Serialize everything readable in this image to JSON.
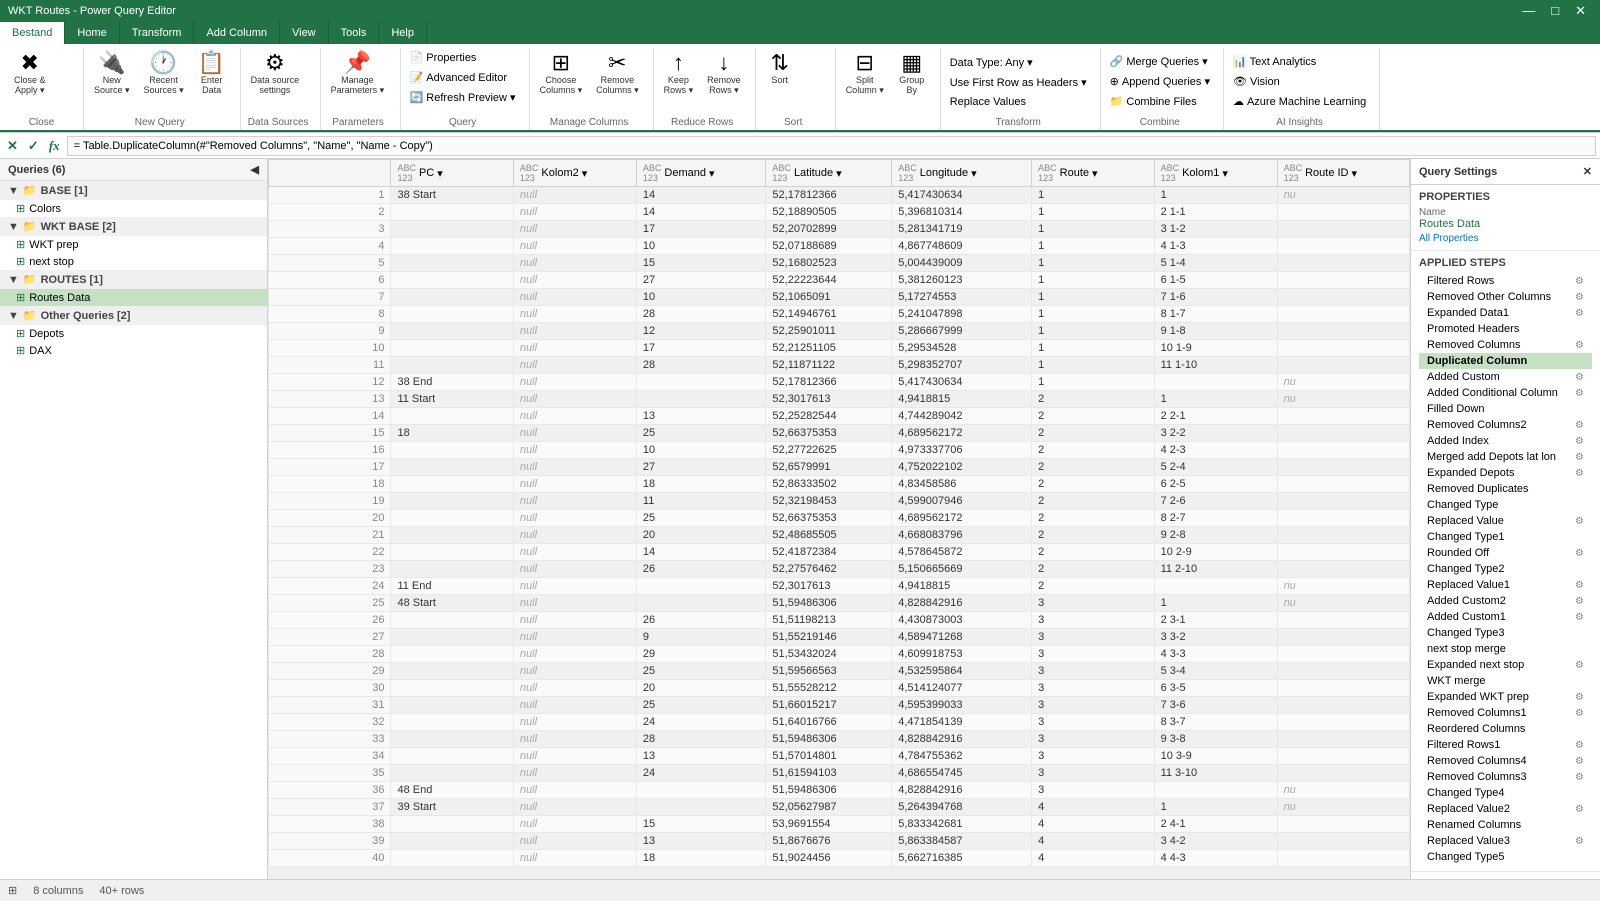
{
  "titleBar": {
    "title": "WKT Routes - Power Query Editor",
    "minimize": "—",
    "maximize": "□",
    "close": "✕"
  },
  "ribbon": {
    "tabs": [
      {
        "label": "Bestand",
        "active": true
      },
      {
        "label": "Home",
        "active": false
      },
      {
        "label": "Transform",
        "active": false
      },
      {
        "label": "Add Column",
        "active": false
      },
      {
        "label": "View",
        "active": false
      },
      {
        "label": "Tools",
        "active": false
      },
      {
        "label": "Help",
        "active": false
      }
    ],
    "groups": {
      "close": {
        "label": "Close",
        "btn": "Close &\nApply ▾"
      },
      "newQuery": {
        "label": "New Query",
        "btns": [
          "New\nSource ▾",
          "Recent\nSources ▾",
          "Enter\nData"
        ]
      },
      "dataSources": {
        "label": "Data Sources",
        "btn": "Data source\nsettings"
      },
      "parameters": {
        "label": "Parameters",
        "btns": [
          "Manage\nParameters ▾"
        ]
      },
      "query": {
        "label": "Query",
        "btns": [
          "Properties",
          "Advanced Editor",
          "Refresh\nPreview ▾"
        ]
      },
      "manageColumns": {
        "label": "Manage Columns",
        "btns": [
          "Choose\nColumns ▾",
          "Remove\nColumns ▾"
        ]
      },
      "reduceRows": {
        "label": "Reduce Rows",
        "btns": [
          "Keep\nRows ▾",
          "Remove\nRows ▾"
        ]
      },
      "sort": {
        "label": "Sort",
        "btns": [
          "Sort"
        ]
      },
      "splitColumn": {
        "label": "Split Column",
        "btn": "Split\nColumn ▾"
      },
      "groupBy": {
        "label": "",
        "btn": "Group\nBy"
      },
      "transform": {
        "label": "Transform",
        "items": [
          "Data Type: Any ▾",
          "Use First Row as Headers ▾",
          "Replace Values"
        ]
      },
      "combine": {
        "label": "Combine",
        "items": [
          "Merge Queries ▾",
          "Append Queries ▾",
          "Combine Files"
        ]
      },
      "aiInsights": {
        "label": "AI Insights",
        "items": [
          "Text Analytics",
          "Vision",
          "Azure Machine Learning"
        ]
      }
    }
  },
  "formulaBar": {
    "formula": "= Table.DuplicateColumn(#\"Removed Columns\", \"Name\", \"Name - Copy\")"
  },
  "sidebar": {
    "header": "Queries (6)",
    "groups": [
      {
        "label": "BASE [1]",
        "expanded": true,
        "items": [
          {
            "name": "Colors",
            "type": "table"
          }
        ]
      },
      {
        "label": "WKT BASE [2]",
        "expanded": true,
        "items": [
          {
            "name": "WKT prep",
            "type": "table"
          },
          {
            "name": "next stop",
            "type": "table"
          }
        ]
      },
      {
        "label": "ROUTES [1]",
        "expanded": true,
        "items": [
          {
            "name": "Routes Data",
            "type": "table",
            "selected": true
          }
        ]
      },
      {
        "label": "Other Queries [2]",
        "expanded": true,
        "items": [
          {
            "name": "Depots",
            "type": "table"
          },
          {
            "name": "DAX",
            "type": "table"
          }
        ]
      }
    ]
  },
  "grid": {
    "columns": [
      {
        "name": "PC",
        "type": "123"
      },
      {
        "name": "Kolom2",
        "type": "ABC 123"
      },
      {
        "name": "Demand",
        "type": "ABC 123"
      },
      {
        "name": "Latitude",
        "type": "ABC 123"
      },
      {
        "name": "Longitude",
        "type": "ABC 123"
      },
      {
        "name": "Route",
        "type": "ABC 123"
      },
      {
        "name": "Kolom1",
        "type": "ABC 123"
      },
      {
        "name": "Route ID",
        "type": "ABC 123"
      }
    ],
    "rows": [
      [
        1,
        "38 Start",
        "null",
        14,
        "52,17812366",
        "5,417430634",
        1,
        1,
        "nu"
      ],
      [
        2,
        "",
        "null",
        14,
        "52,18890505",
        "5,396810314",
        1,
        "2 1-1",
        ""
      ],
      [
        3,
        "",
        "null",
        17,
        "52,20702899",
        "5,281341719",
        1,
        "3 1-2",
        ""
      ],
      [
        4,
        "",
        "null",
        10,
        "52,07188689",
        "4,867748609",
        1,
        "4 1-3",
        ""
      ],
      [
        5,
        "",
        "null",
        15,
        "52,16802523",
        "5,004439009",
        1,
        "5 1-4",
        ""
      ],
      [
        6,
        "",
        "null",
        27,
        "52,22223644",
        "5,381260123",
        1,
        "6 1-5",
        ""
      ],
      [
        7,
        "",
        "null",
        10,
        "52,1065091",
        "5,17274553",
        1,
        "7 1-6",
        ""
      ],
      [
        8,
        "",
        "null",
        28,
        "52,14946761",
        "5,241047898",
        1,
        "8 1-7",
        ""
      ],
      [
        9,
        "",
        "null",
        12,
        "52,25901011",
        "5,286667999",
        1,
        "9 1-8",
        ""
      ],
      [
        10,
        "",
        "null",
        17,
        "52,21251105",
        "5,29534528",
        1,
        "10 1-9",
        ""
      ],
      [
        11,
        "",
        "null",
        28,
        "52,11871122",
        "5,298352707",
        1,
        "11 1-10",
        ""
      ],
      [
        12,
        "38 End",
        "null",
        "",
        "52,17812366",
        "5,417430634",
        1,
        "",
        "nu"
      ],
      [
        13,
        "11 Start",
        "null",
        "",
        "52,3017613",
        "4,9418815",
        2,
        1,
        "nu"
      ],
      [
        14,
        "",
        "null",
        13,
        "52,25282544",
        "4,744289042",
        2,
        "2 2-1",
        ""
      ],
      [
        15,
        "18",
        "null",
        25,
        "52,66375353",
        "4,689562172",
        2,
        "3 2-2",
        ""
      ],
      [
        16,
        "",
        "null",
        10,
        "52,27722625",
        "4,973337706",
        2,
        "4 2-3",
        ""
      ],
      [
        17,
        "",
        "null",
        27,
        "52,6579991",
        "4,752022102",
        2,
        "5 2-4",
        ""
      ],
      [
        18,
        "",
        "null",
        18,
        "52,86333502",
        "4,83458586",
        2,
        "6 2-5",
        ""
      ],
      [
        19,
        "",
        "null",
        11,
        "52,32198453",
        "4,599007946",
        2,
        "7 2-6",
        ""
      ],
      [
        20,
        "",
        "null",
        25,
        "52,66375353",
        "4,689562172",
        2,
        "8 2-7",
        ""
      ],
      [
        21,
        "",
        "null",
        20,
        "52,48685505",
        "4,668083796",
        2,
        "9 2-8",
        ""
      ],
      [
        22,
        "",
        "null",
        14,
        "52,41872384",
        "4,578645872",
        2,
        "10 2-9",
        ""
      ],
      [
        23,
        "",
        "null",
        26,
        "52,27576462",
        "5,150665669",
        2,
        "11 2-10",
        ""
      ],
      [
        24,
        "11 End",
        "null",
        "",
        "52,3017613",
        "4,9418815",
        2,
        "",
        "nu"
      ],
      [
        25,
        "48 Start",
        "null",
        "",
        "51,59486306",
        "4,828842916",
        3,
        1,
        "nu"
      ],
      [
        26,
        "",
        "null",
        26,
        "51,51198213",
        "4,430873003",
        3,
        "2 3-1",
        ""
      ],
      [
        27,
        "",
        "null",
        9,
        "51,55219146",
        "4,589471268",
        3,
        "3 3-2",
        ""
      ],
      [
        28,
        "",
        "null",
        29,
        "51,53432024",
        "4,609918753",
        3,
        "4 3-3",
        ""
      ],
      [
        29,
        "",
        "null",
        25,
        "51,59566563",
        "4,532595864",
        3,
        "5 3-4",
        ""
      ],
      [
        30,
        "",
        "null",
        20,
        "51,55528212",
        "4,514124077",
        3,
        "6 3-5",
        ""
      ],
      [
        31,
        "",
        "null",
        25,
        "51,66015217",
        "4,595399033",
        3,
        "7 3-6",
        ""
      ],
      [
        32,
        "",
        "null",
        24,
        "51,64016766",
        "4,471854139",
        3,
        "8 3-7",
        ""
      ],
      [
        33,
        "",
        "null",
        28,
        "51,59486306",
        "4,828842916",
        3,
        "9 3-8",
        ""
      ],
      [
        34,
        "",
        "null",
        13,
        "51,57014801",
        "4,784755362",
        3,
        "10 3-9",
        ""
      ],
      [
        35,
        "",
        "null",
        24,
        "51,61594103",
        "4,686554745",
        3,
        "11 3-10",
        ""
      ],
      [
        36,
        "48 End",
        "null",
        "",
        "51,59486306",
        "4,828842916",
        3,
        "",
        "nu"
      ],
      [
        37,
        "39 Start",
        "null",
        "",
        "52,05627987",
        "5,264394768",
        4,
        1,
        "nu"
      ],
      [
        38,
        "",
        "null",
        15,
        "53,9691554",
        "5,833342681",
        4,
        "2 4-1",
        ""
      ],
      [
        39,
        "",
        "null",
        13,
        "51,8676676",
        "5,863384587",
        4,
        "3 4-2",
        ""
      ],
      [
        40,
        "",
        "null",
        18,
        "51,9024456",
        "5,662716385",
        4,
        "4 4-3",
        ""
      ]
    ]
  },
  "querySettings": {
    "header": "Query Settings",
    "propertiesLabel": "PROPERTIES",
    "nameLabel": "Name",
    "nameValue": "Routes Data",
    "allPropertiesLink": "All Properties",
    "appliedStepsLabel": "APPLIED STEPS",
    "steps": [
      {
        "name": "Filtered Rows",
        "hasGear": true
      },
      {
        "name": "Removed Other Columns",
        "hasGear": true
      },
      {
        "name": "Expanded Data1",
        "hasGear": true
      },
      {
        "name": "Promoted Headers",
        "hasGear": false
      },
      {
        "name": "Removed Columns",
        "hasGear": true
      },
      {
        "name": "Duplicated Column",
        "hasGear": false,
        "active": true
      },
      {
        "name": "Added Custom",
        "hasGear": true
      },
      {
        "name": "Added Conditional Column",
        "hasGear": true
      },
      {
        "name": "Filled Down",
        "hasGear": false
      },
      {
        "name": "Removed Columns2",
        "hasGear": true
      },
      {
        "name": "Added Index",
        "hasGear": true
      },
      {
        "name": "Merged add Depots lat lon",
        "hasGear": true
      },
      {
        "name": "Expanded Depots",
        "hasGear": true
      },
      {
        "name": "Removed Duplicates",
        "hasGear": false
      },
      {
        "name": "Changed Type",
        "hasGear": false
      },
      {
        "name": "Replaced Value",
        "hasGear": true
      },
      {
        "name": "Changed Type1",
        "hasGear": false
      },
      {
        "name": "Rounded Off",
        "hasGear": true
      },
      {
        "name": "Changed Type2",
        "hasGear": false
      },
      {
        "name": "Replaced Value1",
        "hasGear": true
      },
      {
        "name": "Added Custom2",
        "hasGear": true
      },
      {
        "name": "Added Custom1",
        "hasGear": true
      },
      {
        "name": "Changed Type3",
        "hasGear": false
      },
      {
        "name": "next stop merge",
        "hasGear": false
      },
      {
        "name": "Expanded next stop",
        "hasGear": true
      },
      {
        "name": "WKT merge",
        "hasGear": false
      },
      {
        "name": "Expanded WKT prep",
        "hasGear": true
      },
      {
        "name": "Removed Columns1",
        "hasGear": true
      },
      {
        "name": "Reordered Columns",
        "hasGear": false
      },
      {
        "name": "Filtered Rows1",
        "hasGear": true
      },
      {
        "name": "Removed Columns4",
        "hasGear": true
      },
      {
        "name": "Removed Columns3",
        "hasGear": true
      },
      {
        "name": "Changed Type4",
        "hasGear": false
      },
      {
        "name": "Replaced Value2",
        "hasGear": true
      },
      {
        "name": "Renamed Columns",
        "hasGear": false
      },
      {
        "name": "Replaced Value3",
        "hasGear": true
      },
      {
        "name": "Changed Type5",
        "hasGear": false
      }
    ]
  },
  "statusBar": {
    "columns": "8 columns",
    "rows": "40+ rows"
  }
}
